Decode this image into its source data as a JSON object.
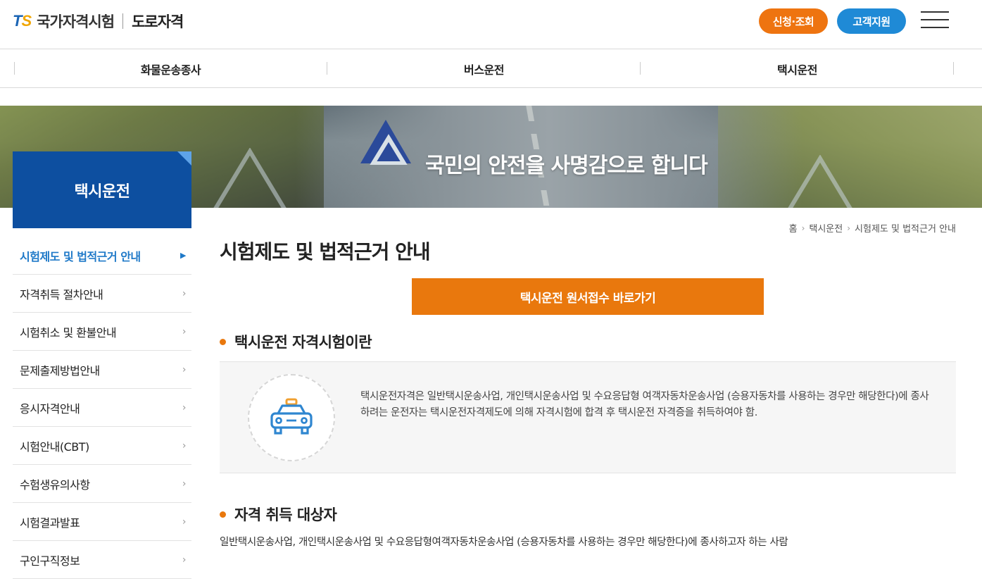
{
  "header": {
    "logo_ts": "TS",
    "logo_name": "국가자격시험",
    "site_name": "도로자격",
    "apply_query_label": "신청·조회",
    "support_label": "고객지원",
    "menu_icon": "hamburger-icon"
  },
  "category_nav": [
    {
      "label": "화물운송종사"
    },
    {
      "label": "버스운전"
    },
    {
      "label": "택시운전"
    }
  ],
  "banner": {
    "slogan": "국민의 안전을 사명감으로 합니다"
  },
  "sidebar": {
    "title": "택시운전",
    "items": [
      {
        "label": "시험제도 및 법적근거 안내",
        "active": true
      },
      {
        "label": "자격취득 절차안내"
      },
      {
        "label": "시험취소 및 환불안내"
      },
      {
        "label": "문제출제방법안내"
      },
      {
        "label": "응시자격안내"
      },
      {
        "label": "시험안내(CBT)"
      },
      {
        "label": "수험생유의사항"
      },
      {
        "label": "시험결과발표"
      },
      {
        "label": "구인구직정보"
      }
    ]
  },
  "breadcrumb": {
    "home": "홈",
    "level1": "택시운전",
    "level2": "시험제도 및 법적근거 안내"
  },
  "main": {
    "page_title": "시험제도 및 법적근거 안내",
    "apply_button": "택시운전 원서접수 바로가기",
    "section1_title": "택시운전 자격시험이란",
    "section1_icon": "taxi-icon",
    "section1_text": "택시운전자격은 일반택시운송사업, 개인택시운송사업 및 수요응답형 여객자동차운송사업 (승용자동차를 사용하는 경우만 해당한다)에 종사하려는 운전자는 택시운전자격제도에 의해 자격시험에 합격 후 택시운전 자격증을 취득하여야 함.",
    "section2_title": "자격 취득 대상자",
    "section2_text": "일반택시운송사업, 개인택시운송사업 및 수요응답형여객자동차운송사업 (승용자동차를 사용하는 경우만 해당한다)에 종사하고자 하는 사람"
  },
  "colors": {
    "accent_orange": "#e9780d",
    "accent_blue": "#1f8ad6",
    "sidebar_blue": "#0d4fa0",
    "active_link": "#1f79c8"
  }
}
